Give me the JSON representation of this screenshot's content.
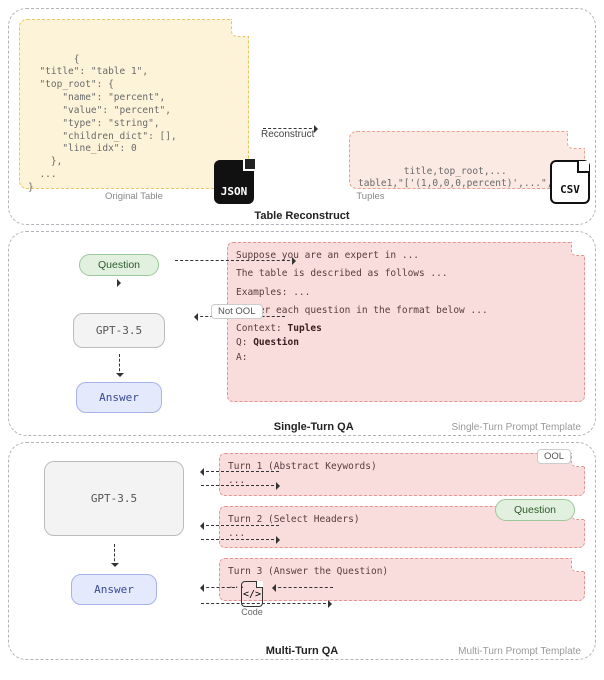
{
  "top": {
    "title": "Table Reconstruct",
    "orig_caption": "Original Table",
    "tuples_caption": "Tuples",
    "reconstruct_label": "Reconstruct",
    "orig_code": "{\n  \"title\": \"table 1\",\n  \"top_root\": {\n      \"name\": \"percent\",\n      \"value\": \"percent\",\n      \"type\": \"string\",\n      \"children_dict\": [],\n      \"line_idx\": 0\n    },\n  ...\n}",
    "tuples_code": "title,top_root,...\ntable1,\"['(1,0,0,0,percent)',...\",...",
    "json_badge": "JSON",
    "csv_badge": "CSV"
  },
  "mid": {
    "title": "Single-Turn QA",
    "subtitle": "Single-Turn Prompt Template",
    "question": "Question",
    "gpt": "GPT-3.5",
    "answer": "Answer",
    "not_ool": "Not OOL",
    "prompt_lines": {
      "l1": "Suppose you are an expert in ...",
      "l2": "The table is described as follows ...",
      "l3": "Examples: ...",
      "l4": "Answer each question in the format below ...",
      "l5a": "Context:",
      "l5b": "Tuples",
      "l6a": "Q:",
      "l6b": "Question",
      "l7": "A:"
    }
  },
  "bot": {
    "title": "Multi-Turn QA",
    "subtitle": "Multi-Turn Prompt Template",
    "gpt": "GPT-3.5",
    "answer": "Answer",
    "ool": "OOL",
    "code": "Code",
    "question": "Question",
    "turn1": "Turn 1 (Abstract Keywords)",
    "turn2": "Turn 2 (Select Headers)",
    "turn3": "Turn 3 (Answer the Question)",
    "ellipsis": "..."
  }
}
